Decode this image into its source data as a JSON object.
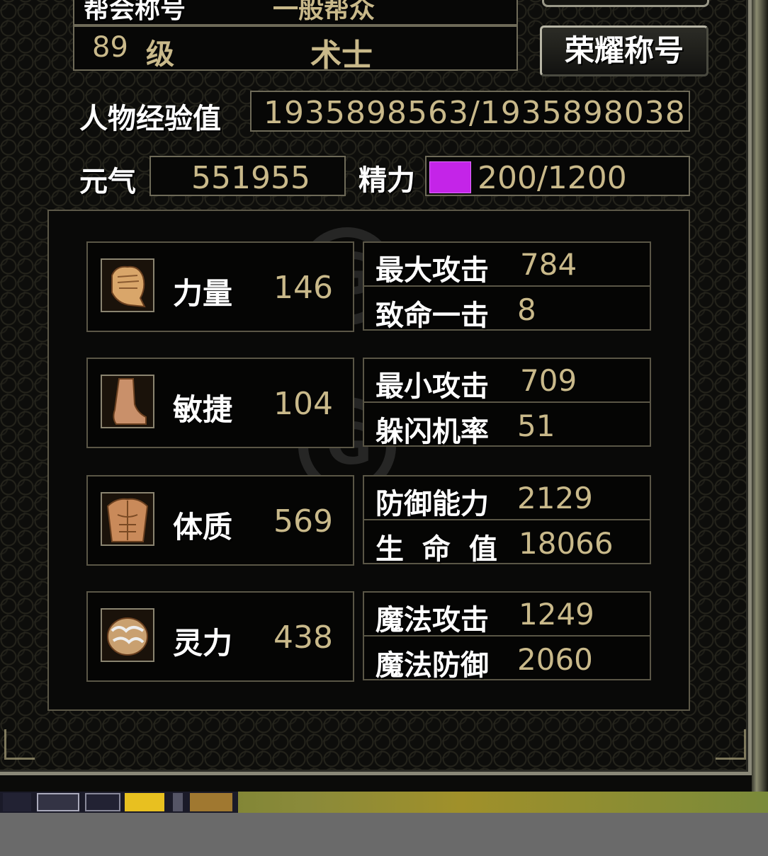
{
  "guild_row": {
    "label": "帮会称号",
    "value": "一般帮众"
  },
  "level_row": {
    "level": "89",
    "unit": "级",
    "class_name": "术士"
  },
  "honor_button": {
    "label": "荣耀称号"
  },
  "experience": {
    "label": "人物经验值",
    "value": "1935898563/1935898038"
  },
  "yuanqi": {
    "label": "元气",
    "value": "551955"
  },
  "jingli": {
    "label": "精力",
    "value": "200/1200",
    "swatch_color": "#c424e8"
  },
  "attributes": [
    {
      "name": "力量",
      "value": "146",
      "icon": "fist-icon",
      "derived": [
        {
          "label": "最大攻击",
          "value": "784"
        },
        {
          "label": "致命一击",
          "value": "8"
        }
      ]
    },
    {
      "name": "敏捷",
      "value": "104",
      "icon": "foot-icon",
      "derived": [
        {
          "label": "最小攻击",
          "value": "709"
        },
        {
          "label": "躲闪机率",
          "value": "51"
        }
      ]
    },
    {
      "name": "体质",
      "value": "569",
      "icon": "torso-icon",
      "derived": [
        {
          "label": "防御能力",
          "value": "2129"
        },
        {
          "label": "生 命 值",
          "value": "18066"
        }
      ]
    },
    {
      "name": "灵力",
      "value": "438",
      "icon": "brain-icon",
      "derived": [
        {
          "label": "魔法攻击",
          "value": "1249"
        },
        {
          "label": "魔法防御",
          "value": "2060"
        }
      ]
    }
  ],
  "colors": {
    "value_text": "#c9b98a",
    "label_text": "#ffffff",
    "frame": "#6e6a58"
  }
}
